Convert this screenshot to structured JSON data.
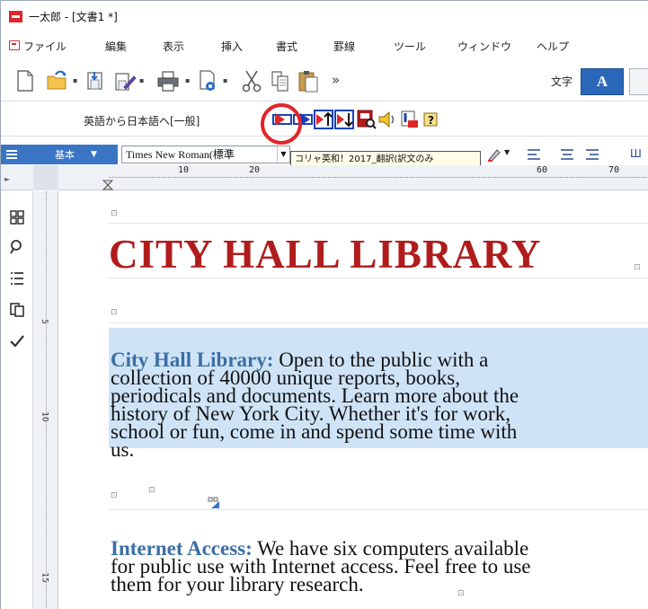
{
  "window": {
    "title": "一太郎 - [文書1 *]"
  },
  "menu": {
    "items": [
      "ファイル",
      "編集",
      "表示",
      "挿入",
      "書式",
      "罫線",
      "ツール",
      "ウィンドウ",
      "ヘルプ"
    ]
  },
  "toolbar": {
    "more": "»",
    "text_label": "文字",
    "text_button": "A"
  },
  "translation_bar": {
    "label": "英語から日本語へ[一般]"
  },
  "format_bar": {
    "style": "基本",
    "font": "Times New Roman(標準"
  },
  "tooltip": {
    "line1": "コリャ英和！2017_翻訳(訳文のみ",
    "line2": ")"
  },
  "ruler": {
    "marks": [
      "10",
      "20",
      "60",
      "70"
    ],
    "vmarks": [
      "5",
      "10",
      "15"
    ]
  },
  "document": {
    "title": "CITY HALL LIBRARY",
    "para1_lead": "City Hall Library:",
    "para1_lines": [
      " Open to the public with a",
      "collection of 40000 unique reports, books,",
      "periodicals and documents. Learn more about the",
      "history of New York City. Whether it's for work,",
      "school or fun, come in and spend some time with",
      "us."
    ],
    "para2_lead": "Internet Access:",
    "para2_lines": [
      " We have six computers available",
      "for public use with Internet access. Feel free to use",
      "them for your library research."
    ]
  },
  "colors": {
    "accent": "#3a75c4",
    "title_red": "#b01c1c",
    "selection": "#cfe3f7",
    "highlight": "#e1262a"
  }
}
